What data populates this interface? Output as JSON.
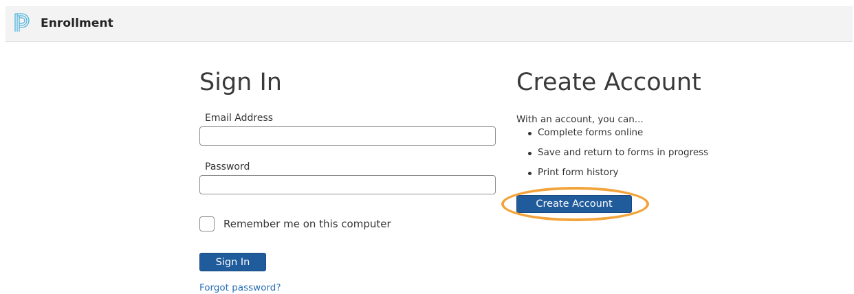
{
  "header": {
    "brand": "Enrollment",
    "logo_icon": "powerschool-logo-icon",
    "background": "#f3f3f3"
  },
  "sign_in": {
    "title": "Sign In",
    "email_label": "Email Address",
    "email_value": "",
    "password_label": "Password",
    "password_value": "",
    "remember_label": "Remember me on this computer",
    "remember_checked": false,
    "submit_label": "Sign In",
    "forgot_link": "Forgot password?"
  },
  "create_account": {
    "title": "Create Account",
    "intro": "With an account, you can...",
    "benefits": [
      "Complete forms online",
      "Save and return to forms in progress",
      "Print form history"
    ],
    "button_label": "Create Account",
    "highlight_color": "#f2a33a"
  },
  "colors": {
    "primary_button": "#205b9b",
    "link": "#2a6fb4",
    "logo": "#4db3dc"
  }
}
